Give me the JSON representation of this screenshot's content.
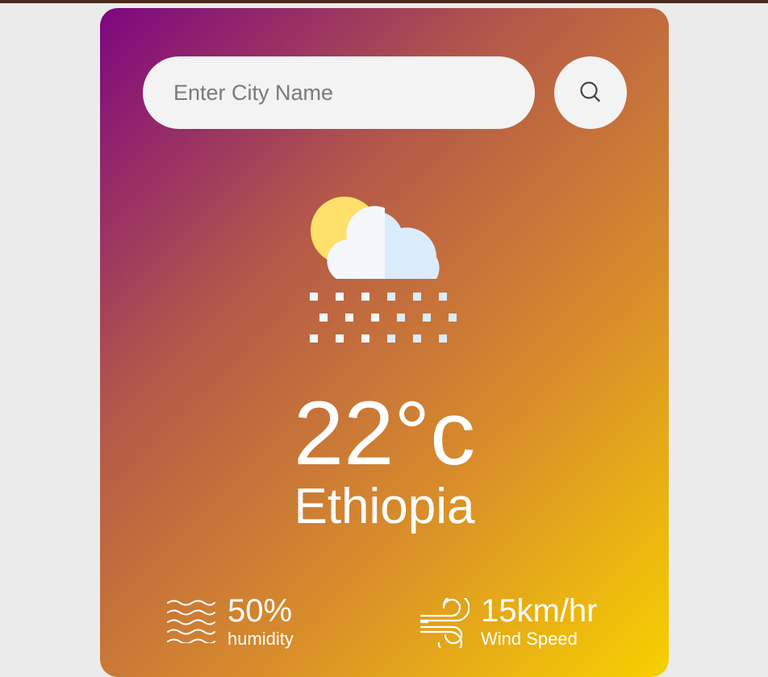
{
  "search": {
    "placeholder": "Enter City Name",
    "value": ""
  },
  "weather": {
    "icon": "sun-cloud-snow-icon",
    "temperature": "22°c",
    "city": "Ethiopia"
  },
  "details": {
    "humidity": {
      "value": "50%",
      "label": "humidity",
      "icon": "humidity-waves-icon"
    },
    "wind": {
      "value": "15km/hr",
      "label": "Wind Speed",
      "icon": "wind-icon"
    }
  },
  "colors": {
    "gradient_start": "#7d0780",
    "gradient_end": "#f8d000",
    "page_background": "#ebebeb",
    "input_background": "#f3f3f3"
  }
}
